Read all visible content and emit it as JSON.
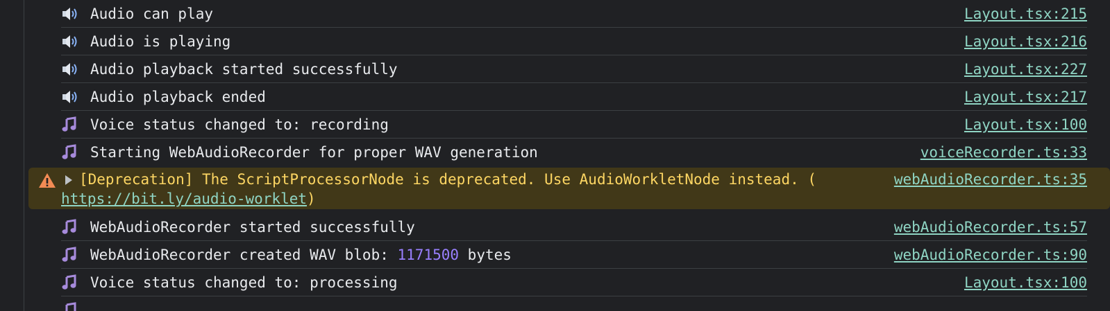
{
  "console": {
    "rows_top": [
      {
        "icon": "speaker-icon",
        "text": "Audio can play",
        "source": "Layout.tsx:215"
      },
      {
        "icon": "speaker-icon",
        "text": "Audio is playing",
        "source": "Layout.tsx:216"
      },
      {
        "icon": "speaker-icon",
        "text": "Audio playback started successfully",
        "source": "Layout.tsx:227"
      },
      {
        "icon": "speaker-icon",
        "text": "Audio playback ended",
        "source": "Layout.tsx:217"
      },
      {
        "icon": "music-note-icon",
        "text": "Voice status changed to: recording",
        "source": "Layout.tsx:100"
      },
      {
        "icon": "music-note-icon",
        "text": "Starting WebAudioRecorder for proper WAV generation",
        "source": "voiceRecorder.ts:33"
      }
    ],
    "warning": {
      "icon": "warning-icon",
      "text_line1": "[Deprecation] The ScriptProcessorNode is deprecated. Use AudioWorkletNode instead. (",
      "link": "https://bit.ly/audio-worklet",
      "close_paren": ")",
      "source": "webAudioRecorder.ts:35"
    },
    "rows_bottom": [
      {
        "icon": "music-note-icon",
        "text": "WebAudioRecorder started successfully",
        "source": "webAudioRecorder.ts:57"
      },
      {
        "icon": "music-note-icon",
        "text_prefix": "WebAudioRecorder created WAV blob: ",
        "number": "1171500",
        "text_suffix": " bytes",
        "source": "webAudioRecorder.ts:90"
      },
      {
        "icon": "music-note-icon",
        "text": "Voice status changed to: processing",
        "source": "Layout.tsx:100"
      }
    ]
  },
  "colors": {
    "background": "#202124",
    "text": "#e8eaed",
    "link": "#8fd5c4",
    "warning_bg": "#413818",
    "warning_text": "#fdd663",
    "number": "#9980ff",
    "note_icon": "#a78bdc"
  }
}
